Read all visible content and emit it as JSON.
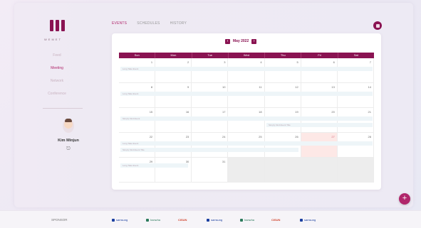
{
  "app": {
    "logo_text": "WEMET"
  },
  "sidebar": {
    "items": [
      {
        "label": "Feed",
        "active": false
      },
      {
        "label": "Meeting",
        "active": true
      },
      {
        "label": "Network",
        "active": false
      },
      {
        "label": "Conference",
        "active": false
      }
    ],
    "user_name": "Kim Minjun"
  },
  "tabs": [
    {
      "label": "EVENTS",
      "active": true
    },
    {
      "label": "SCHEDULES",
      "active": false
    },
    {
      "label": "HISTORY",
      "active": false
    }
  ],
  "calendar": {
    "month_label": "May 2022",
    "prev_icon": "‹",
    "next_icon": "›",
    "weekdays": [
      "Sun",
      "Mon",
      "Tue",
      "Wed",
      "Thu",
      "Fri",
      "Sat"
    ],
    "weeks": [
      [
        {
          "num": "",
          "state": "normal"
        },
        {
          "num": "1",
          "state": "normal"
        }
      ]
    ],
    "days": [
      [
        "1",
        "2",
        "3",
        "4",
        "5",
        "6",
        "7"
      ],
      [
        "8",
        "9",
        "10",
        "11",
        "12",
        "13",
        "14"
      ],
      [
        "15",
        "16",
        "17",
        "18",
        "19",
        "20",
        "21"
      ],
      [
        "22",
        "23",
        "24",
        "25",
        "26",
        "27",
        "28"
      ],
      [
        "29",
        "30",
        "31",
        "",
        "",
        "",
        ""
      ]
    ],
    "event_label": "Long Take Event",
    "event_label_2": "Simply Kind Event",
    "event_label_3": "Simply Kind Event Title"
  },
  "fab": {
    "icon": "+"
  },
  "sponsor": {
    "label": "SPONSOR",
    "logos": [
      "samsung",
      "hanwha",
      "CISUN",
      "samsung",
      "hanwha",
      "CISUN",
      "samsung"
    ]
  },
  "colors": {
    "accent": "#8a1352",
    "accent_light": "#b0266b",
    "highlight_day": "#fde8e6"
  }
}
